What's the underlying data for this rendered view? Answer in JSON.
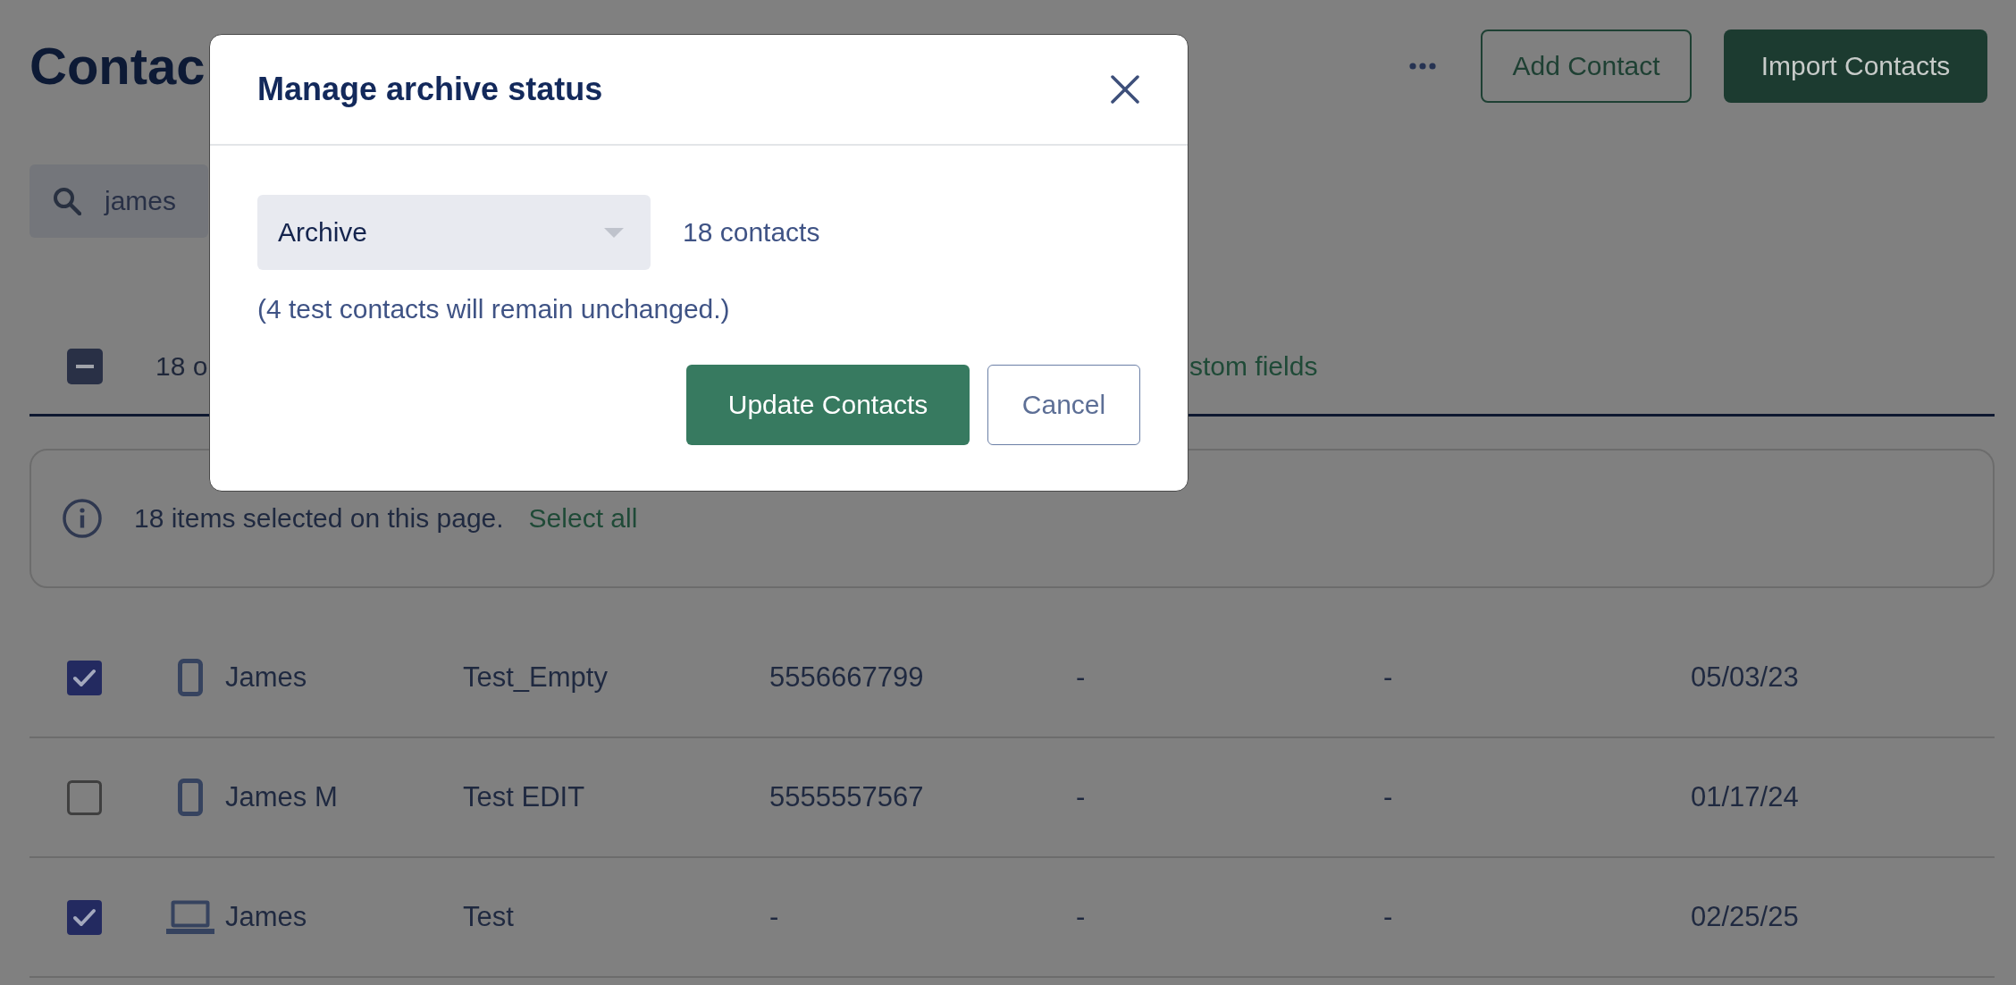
{
  "header": {
    "title": "Contac",
    "buttons": [
      {
        "label": "Add Contact",
        "kind": "outline"
      },
      {
        "label": "Import Contacts",
        "kind": "primary"
      }
    ]
  },
  "search": {
    "value": "james"
  },
  "selection_bar": {
    "indeterminate": true,
    "label": "18 o",
    "link": "stom fields"
  },
  "banner": {
    "message": "18 items selected on this page.",
    "link": "Select all"
  },
  "table": {
    "rows": [
      {
        "selected": true,
        "kind": "mobile",
        "cells": [
          "James",
          "Test_Empty",
          "5556667799",
          "-",
          "-",
          "05/03/23"
        ]
      },
      {
        "selected": false,
        "kind": "mobile",
        "cells": [
          "James M",
          "Test EDIT",
          "5555557567",
          "-",
          "-",
          "01/17/24"
        ]
      },
      {
        "selected": true,
        "kind": "desktop",
        "cells": [
          "James",
          "Test",
          "-",
          "-",
          "-",
          "02/25/25"
        ]
      }
    ]
  },
  "modal": {
    "title": "Manage archive status",
    "select": {
      "value": "Archive"
    },
    "count": "18 contacts",
    "note": "(4 test contacts will remain unchanged.)",
    "buttons": [
      {
        "label": "Update Contacts",
        "kind": "primary"
      },
      {
        "label": "Cancel",
        "kind": "secondary"
      }
    ]
  }
}
